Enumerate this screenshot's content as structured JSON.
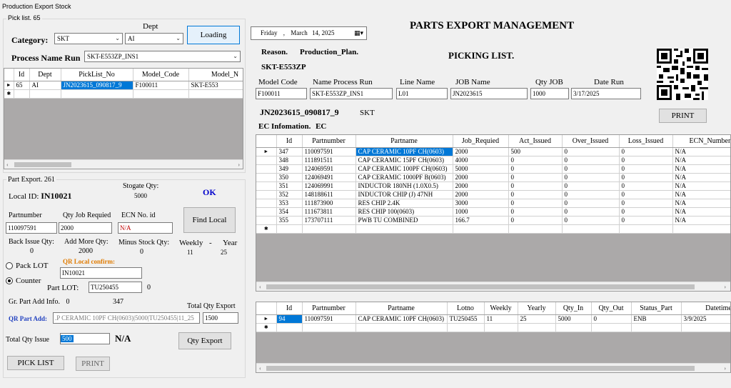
{
  "window_title": "Production Export Stock",
  "left": {
    "pick_list_label": "Pick list.",
    "pick_list_count": "65",
    "dept_label": "Dept",
    "category_label": "Category:",
    "category_value": "SKT",
    "dept_value": "AI",
    "loading_button": "Loading",
    "process_label": "Process Name Run",
    "process_value": "SKT-E553ZP_INS1",
    "pick_grid": {
      "columns": [
        "Id",
        "Dept",
        "PickList_No",
        "Model_Code",
        "Model_N"
      ],
      "rows": [
        [
          "65",
          "AI",
          "JN2023615_090817_9",
          "F100011",
          "SKT-E553"
        ]
      ]
    },
    "part_export_label": "Part Export.",
    "part_export_count": "261",
    "stogate_label": "Stogate Qty:",
    "stogate_value": "5000",
    "local_id_label": "Local ID:",
    "local_id_value": "IN10021",
    "ok_text": "OK",
    "partnumber_label": "Partnumber",
    "qty_job_label": "Qty Job Requied",
    "ecn_label": "ECN No. id",
    "partnumber_value": "110097591",
    "qty_job_value": "2000",
    "ecn_value": "N/A",
    "find_local_button": "Find Local",
    "back_issue_label": "Back Issue Qty:",
    "add_more_label": "Add More Qty:",
    "minus_stock_label": "Minus Stock Qty:",
    "weekly_label": "Weekly",
    "dash": "-",
    "year_label": "Year",
    "back_issue_value": "0",
    "add_more_value": "2000",
    "minus_stock_value": "0",
    "weekly_value": "11",
    "year_value": "25",
    "qr_local_label": "QR Local confirm:",
    "pack_lot_label": "Pack LOT",
    "counter_label": "Counter",
    "qr_local_value": "IN10021",
    "part_lot_label": "Part LOT:",
    "part_lot_value": "TU250455",
    "part_lot_extra": "0",
    "gr_part_label": "Gr. Part Add Info.",
    "gr_part_value": "0",
    "gr_part_qty": "347",
    "total_qty_export_label": "Total Qty Export",
    "qr_part_add_label": "QR Part Add:",
    "qr_part_add_value": ".P CERAMIC 10PF CH(0603)|5000|TU250455|11_25",
    "total_qty_export_value": "1500",
    "total_qty_issue_label": "Total Qty Issue",
    "total_qty_issue_value": "500",
    "na_text": "N/A",
    "qty_export_button": "Qty Export",
    "pick_list_button": "PICK LIST",
    "print_button": "PRINT"
  },
  "right": {
    "date_day": "Friday",
    "date_sep": ",",
    "date_month": "March",
    "date_rest": "14, 2025",
    "main_title": "PARTS EXPORT MANAGEMENT",
    "reason_label": "Reason.",
    "reason_value": "Production_Plan.",
    "picking_title": "PICKING LIST.",
    "model_name": "SKT-E553ZP",
    "fields": {
      "model_code_label": "Model Code",
      "name_process_label": "Name Process Run",
      "line_name_label": "Line Name",
      "job_name_label": "JOB Name",
      "qty_job_label": "Qty JOB",
      "date_run_label": "Date Run",
      "model_code": "F100011",
      "name_process": "SKT-E553ZP_INS1",
      "line_name": "L01",
      "job_name": "JN2023615",
      "qty_job": "1000",
      "date_run": "3/17/2025"
    },
    "picklist_no": "JN2023615_090817_9",
    "picklist_dept": "SKT",
    "print_button": "PRINT",
    "ec_info_label": "EC Infomation.",
    "ec_info_value": "EC",
    "ec_grid": {
      "columns": [
        "Id",
        "Partnumber",
        "Partname",
        "Job_Requied",
        "Act_Issued",
        "Over_Issued",
        "Loss_Issued",
        "ECN_Number_N"
      ],
      "rows": [
        [
          "347",
          "110097591",
          "CAP CERAMIC 10PF CH(0603)",
          "2000",
          "500",
          "0",
          "0",
          "N/A"
        ],
        [
          "348",
          "111891511",
          "CAP CERAMIC 15PF CH(0603)",
          "4000",
          "0",
          "0",
          "0",
          "N/A"
        ],
        [
          "349",
          "124069591",
          "CAP CERAMIC 100PF CH(0603)",
          "5000",
          "0",
          "0",
          "0",
          "N/A"
        ],
        [
          "350",
          "124069491",
          "CAP CERAMIC 1000PF B(0603)",
          "2000",
          "0",
          "0",
          "0",
          "N/A"
        ],
        [
          "351",
          "124069991",
          "INDUCTOR 180NH (1.0X0.5)",
          "2000",
          "0",
          "0",
          "0",
          "N/A"
        ],
        [
          "352",
          "148188611",
          "INDUCTOR CHIP (J) 47NH",
          "2000",
          "0",
          "0",
          "0",
          "N/A"
        ],
        [
          "353",
          "111873900",
          "RES CHIP 2.4K",
          "3000",
          "0",
          "0",
          "0",
          "N/A"
        ],
        [
          "354",
          "111673811",
          "RES CHIP 100(0603)",
          "1000",
          "0",
          "0",
          "0",
          "N/A"
        ],
        [
          "355",
          "173707111",
          "PWB TU COMBINED",
          "166.7",
          "0",
          "0",
          "0",
          "N/A"
        ]
      ]
    },
    "lot_grid": {
      "columns": [
        "Id",
        "Partnumber",
        "Partname",
        "Lotno",
        "Weekly",
        "Yearly",
        "Qty_In",
        "Qty_Out",
        "Status_Part",
        "Datetime"
      ],
      "rows": [
        [
          "94",
          "110097591",
          "CAP CERAMIC 10PF CH(0603)",
          "TU250455",
          "11",
          "25",
          "5000",
          "0",
          "ENB",
          "3/9/2025"
        ]
      ]
    }
  }
}
